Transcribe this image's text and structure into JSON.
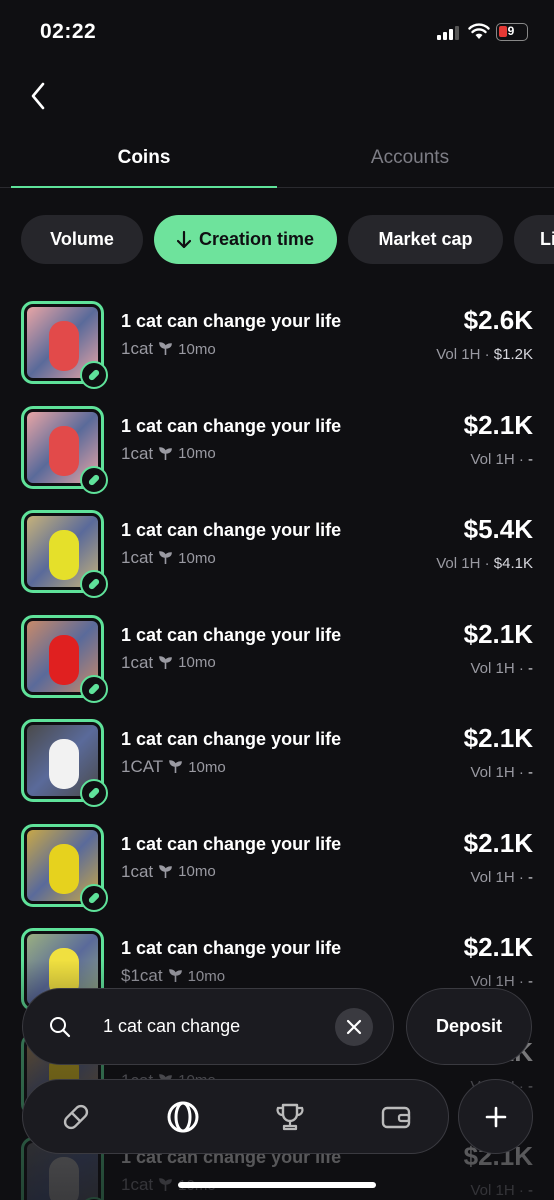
{
  "status_bar": {
    "time": "02:22",
    "battery": "9"
  },
  "tabs": [
    {
      "label": "Coins",
      "active": true
    },
    {
      "label": "Accounts",
      "active": false
    }
  ],
  "filters": [
    {
      "label": "Volume",
      "active": false
    },
    {
      "label": "Creation time",
      "active": true,
      "icon": "arrow-down-icon"
    },
    {
      "label": "Market cap",
      "active": false
    },
    {
      "label": "Li",
      "active": false
    }
  ],
  "coins": [
    {
      "name": "1 cat can change your life",
      "ticker": "1cat",
      "age": "10mo",
      "price": "$2.6K",
      "vol_label": "Vol 1H",
      "vol_value": "$1.2K",
      "thumb_color": "#e24a4a",
      "thumb_bg": "#e8a5a5"
    },
    {
      "name": "1 cat can change your life",
      "ticker": "1cat",
      "age": "10mo",
      "price": "$2.1K",
      "vol_label": "Vol 1H",
      "vol_value": "-",
      "thumb_color": "#e24a4a",
      "thumb_bg": "#e8a5a5"
    },
    {
      "name": "1 cat can change your life",
      "ticker": "1cat",
      "age": "10mo",
      "price": "$5.4K",
      "vol_label": "Vol 1H",
      "vol_value": "$4.1K",
      "thumb_color": "#e5e02a",
      "thumb_bg": "#c6b27a"
    },
    {
      "name": "1 cat can change your life",
      "ticker": "1cat",
      "age": "10mo",
      "price": "$2.1K",
      "vol_label": "Vol 1H",
      "vol_value": "-",
      "thumb_color": "#e02020",
      "thumb_bg": "#c88a6a"
    },
    {
      "name": "1 cat can change your life",
      "ticker": "1CAT",
      "age": "10mo",
      "price": "$2.1K",
      "vol_label": "Vol 1H",
      "vol_value": "-",
      "thumb_color": "#f2f2f2",
      "thumb_bg": "#4a4a4a"
    },
    {
      "name": "1 cat can change your life",
      "ticker": "1cat",
      "age": "10mo",
      "price": "$2.1K",
      "vol_label": "Vol 1H",
      "vol_value": "-",
      "thumb_color": "#e6d21e",
      "thumb_bg": "#c8a848"
    },
    {
      "name": "1 cat can change your life",
      "ticker": "$1cat",
      "age": "10mo",
      "price": "$2.1K",
      "vol_label": "Vol 1H",
      "vol_value": "-",
      "thumb_color": "#f0e040",
      "thumb_bg": "#9ab080"
    },
    {
      "name": "1 cat can change your life",
      "ticker": "1cat",
      "age": "10mo",
      "price": "$2.1K",
      "vol_label": "Vol 1H",
      "vol_value": "-",
      "thumb_color": "#f0d020",
      "thumb_bg": "#b89050"
    },
    {
      "name": "1 cat can change your life",
      "ticker": "1cat",
      "age": "10mo",
      "price": "$2.1K",
      "vol_label": "Vol 1H",
      "vol_value": "-",
      "thumb_color": "#c0c0c0",
      "thumb_bg": "#707070"
    }
  ],
  "search": {
    "value": "1 cat can change"
  },
  "deposit_label": "Deposit",
  "nav": [
    {
      "icon": "pill-icon"
    },
    {
      "icon": "orbit-icon",
      "active": true
    },
    {
      "icon": "trophy-icon"
    },
    {
      "icon": "wallet-icon"
    }
  ],
  "colors": {
    "accent": "#6ee39c",
    "background": "#0f0f12",
    "surface": "#1b1b20",
    "muted": "#9a9aa2"
  }
}
